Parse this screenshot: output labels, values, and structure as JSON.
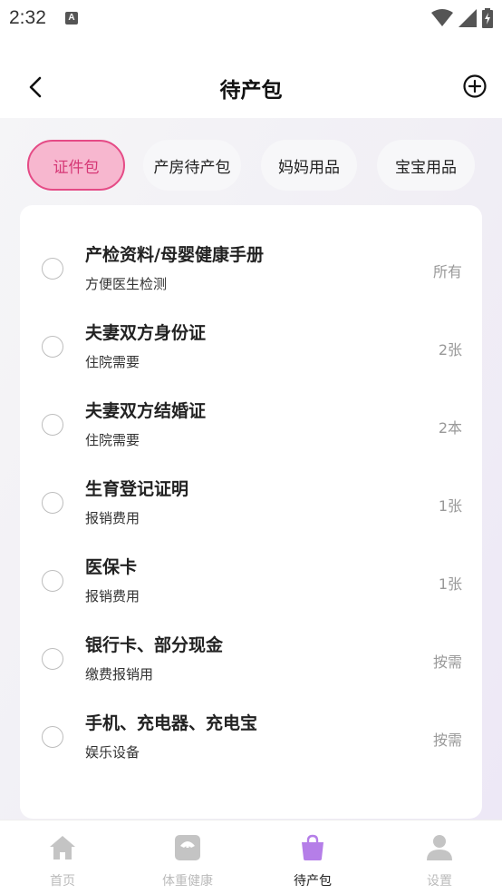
{
  "status_bar": {
    "time": "2:32",
    "notification_letter": "A"
  },
  "header": {
    "title": "待产包"
  },
  "tabs": [
    {
      "label": "证件包",
      "active": true
    },
    {
      "label": "产房待产包",
      "active": false
    },
    {
      "label": "妈妈用品",
      "active": false
    },
    {
      "label": "宝宝用品",
      "active": false
    }
  ],
  "items": [
    {
      "title": "产检资料/母婴健康手册",
      "subtitle": "方便医生检测",
      "qty": "所有"
    },
    {
      "title": "夫妻双方身份证",
      "subtitle": "住院需要",
      "qty": "2张"
    },
    {
      "title": "夫妻双方结婚证",
      "subtitle": "住院需要",
      "qty": "2本"
    },
    {
      "title": "生育登记证明",
      "subtitle": "报销费用",
      "qty": "1张"
    },
    {
      "title": "医保卡",
      "subtitle": "报销费用",
      "qty": "1张"
    },
    {
      "title": "银行卡、部分现金",
      "subtitle": "缴费报销用",
      "qty": "按需"
    },
    {
      "title": "手机、充电器、充电宝",
      "subtitle": "娱乐设备",
      "qty": "按需"
    }
  ],
  "bottom_nav": [
    {
      "label": "首页",
      "icon": "home-icon",
      "active": false
    },
    {
      "label": "体重健康",
      "icon": "scale-icon",
      "active": false
    },
    {
      "label": "待产包",
      "icon": "bag-icon",
      "active": true
    },
    {
      "label": "设置",
      "icon": "person-icon",
      "active": false
    }
  ],
  "colors": {
    "accent_pink": "#e54b86",
    "active_tab_fill": "#f7b7cf",
    "active_nav_icon": "#b57ee8",
    "inactive_nav": "#bbbbbb"
  }
}
